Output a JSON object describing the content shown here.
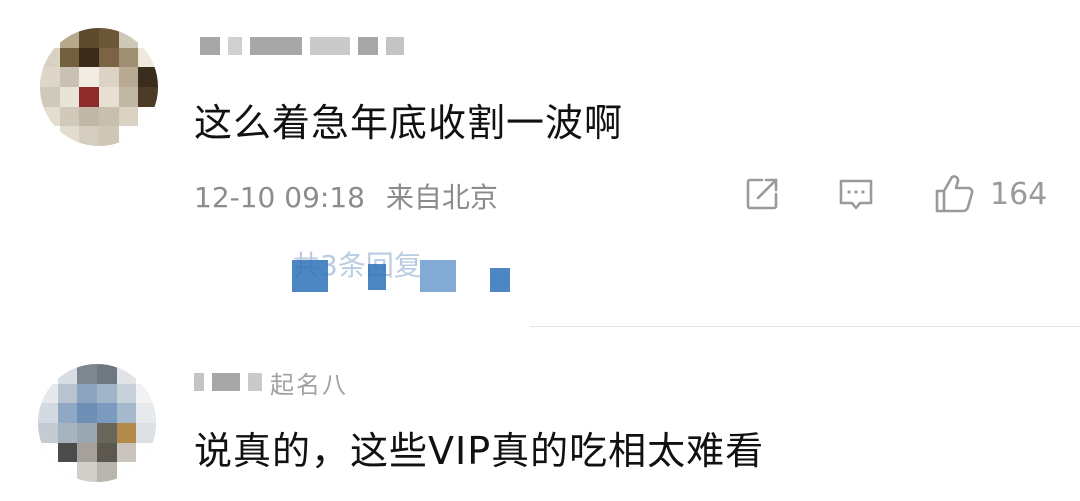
{
  "comments": [
    {
      "username": "",
      "content": "这么着急年底收割一波啊",
      "time": "12-10 09:18",
      "location": "来自北京",
      "likes": "164",
      "icons": [
        "share-icon",
        "comment-icon",
        "like-icon"
      ],
      "replies_text": "共3条回复"
    },
    {
      "username": "起名八",
      "content": "说真的，这些VIP真的吃相太难看"
    }
  ],
  "colors": {
    "link": "#3a6fb0",
    "meta": "#8c8c8c",
    "text": "#111111"
  }
}
